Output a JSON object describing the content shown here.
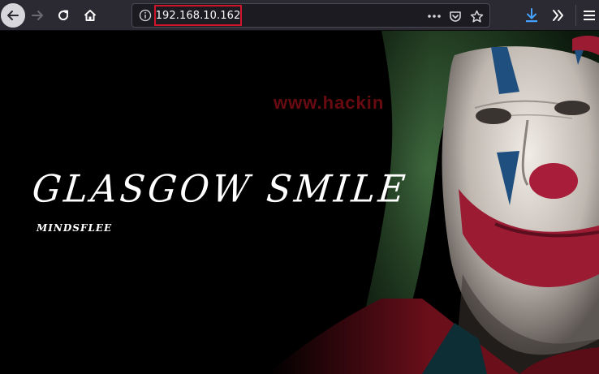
{
  "browser": {
    "url": "192.168.10.162",
    "colors": {
      "toolbar": "#2b2a33",
      "highlight": "#d0152a",
      "download": "#45a1ff"
    },
    "icons": {
      "back": "back-arrow-icon",
      "forward": "forward-arrow-icon",
      "reload": "reload-icon",
      "home": "home-icon",
      "info": "info-icon",
      "page_actions": "more-dots-icon",
      "pocket": "pocket-icon",
      "bookmark": "star-icon",
      "download": "download-icon",
      "overflow": "double-chevron-icon",
      "menu": "hamburger-icon"
    }
  },
  "page": {
    "title": "Glasgow Smile",
    "subtitle": "Mindsflee",
    "watermark": "www.hackin"
  }
}
